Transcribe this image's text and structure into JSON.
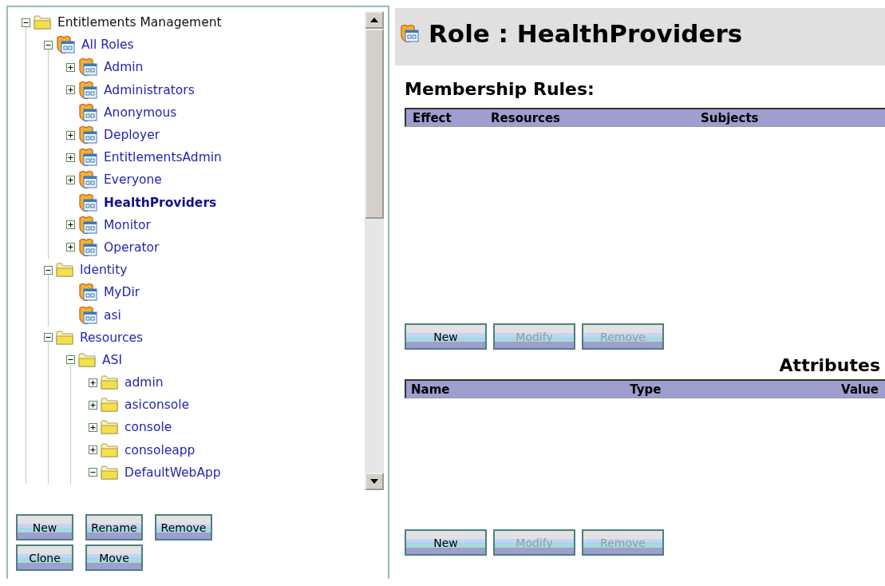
{
  "tree": {
    "nodes": [
      {
        "label": "Entitlements Management",
        "kind": "folder",
        "expanded": true,
        "selected": false,
        "children": [
          {
            "label": "All Roles",
            "kind": "role",
            "expanded": true,
            "selected": false,
            "children": [
              {
                "label": "Admin",
                "kind": "role",
                "expanded": false,
                "selected": false
              },
              {
                "label": "Administrators",
                "kind": "role",
                "expanded": false,
                "selected": false
              },
              {
                "label": "Anonymous",
                "kind": "role",
                "selected": false
              },
              {
                "label": "Deployer",
                "kind": "role",
                "expanded": false,
                "selected": false
              },
              {
                "label": "EntitlementsAdmin",
                "kind": "role",
                "expanded": false,
                "selected": false
              },
              {
                "label": "Everyone",
                "kind": "role",
                "expanded": false,
                "selected": false
              },
              {
                "label": "HealthProviders",
                "kind": "role",
                "selected": true
              },
              {
                "label": "Monitor",
                "kind": "role",
                "expanded": false,
                "selected": false
              },
              {
                "label": "Operator",
                "kind": "role",
                "expanded": false,
                "selected": false
              }
            ]
          },
          {
            "label": "Identity",
            "kind": "folder",
            "expanded": true,
            "selected": false,
            "children": [
              {
                "label": "MyDir",
                "kind": "role",
                "selected": false
              },
              {
                "label": "asi",
                "kind": "role",
                "selected": false
              }
            ]
          },
          {
            "label": "Resources",
            "kind": "folder",
            "expanded": true,
            "selected": false,
            "children": [
              {
                "label": "ASI",
                "kind": "folder",
                "expanded": true,
                "selected": false,
                "children": [
                  {
                    "label": "admin",
                    "kind": "folder",
                    "expanded": false,
                    "selected": false
                  },
                  {
                    "label": "asiconsole",
                    "kind": "folder",
                    "expanded": false,
                    "selected": false
                  },
                  {
                    "label": "console",
                    "kind": "folder",
                    "expanded": false,
                    "selected": false
                  },
                  {
                    "label": "consoleapp",
                    "kind": "folder",
                    "expanded": false,
                    "selected": false
                  },
                  {
                    "label": "DefaultWebApp",
                    "kind": "folder",
                    "expanded": true,
                    "selected": false
                  }
                ]
              }
            ]
          }
        ]
      }
    ]
  },
  "tree_buttons": [
    {
      "label": "New"
    },
    {
      "label": "Rename"
    },
    {
      "label": "Remove"
    },
    {
      "label": "Clone"
    },
    {
      "label": "Move"
    }
  ],
  "detail": {
    "title": "Role : HealthProviders",
    "membership": {
      "heading": "Membership Rules:",
      "columns": [
        "Effect",
        "Resources",
        "Subjects"
      ],
      "buttons": [
        {
          "label": "New",
          "disabled": false
        },
        {
          "label": "Modify",
          "disabled": true
        },
        {
          "label": "Remove",
          "disabled": true
        }
      ]
    },
    "attributes": {
      "heading": "Attributes",
      "columns": [
        "Name",
        "Type",
        "Value"
      ],
      "buttons": [
        {
          "label": "New",
          "disabled": false
        },
        {
          "label": "Modify",
          "disabled": true
        },
        {
          "label": "Remove",
          "disabled": true
        }
      ]
    }
  }
}
